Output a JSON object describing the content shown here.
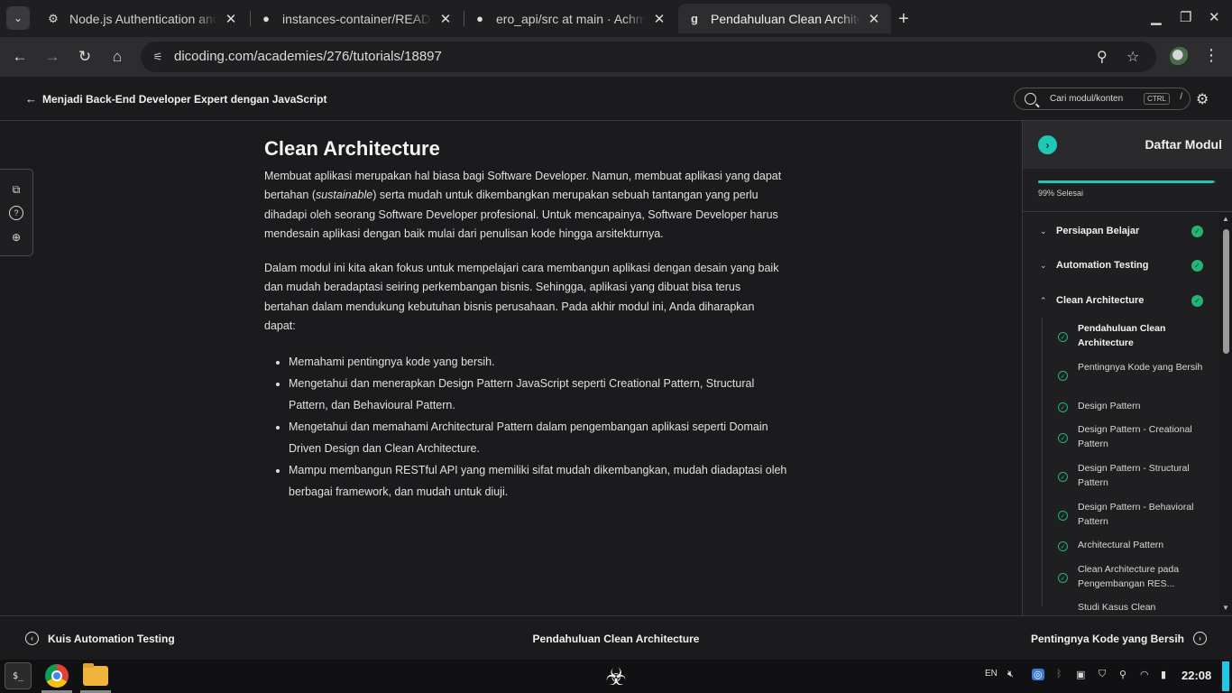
{
  "browser": {
    "tabs": [
      {
        "title": "Node.js Authentication and R",
        "icon": "settings-gear-icon"
      },
      {
        "title": "instances-container/READM",
        "icon": "github-icon"
      },
      {
        "title": "ero_api/src at main · Achmad",
        "icon": "github-icon"
      },
      {
        "title": "Pendahuluan Clean Architect",
        "icon": "dicoding-icon",
        "active": true
      }
    ],
    "url": "dicoding.com/academies/276/tutorials/18897"
  },
  "header": {
    "back_label": "Menjadi Back-End Developer Expert dengan JavaScript",
    "search_placeholder": "Cari modul/konten",
    "search_shortcut": "CTRL",
    "search_slash": "/"
  },
  "article": {
    "title": "Clean Architecture",
    "para1_a": "Membuat aplikasi merupakan hal biasa bagi Software Developer. Namun, membuat aplikasi yang dapat bertahan (",
    "para1_em": "sustainable",
    "para1_b": ") serta mudah untuk dikembangkan merupakan sebuah tantangan yang perlu dihadapi oleh seorang Software Developer profesional. Untuk mencapainya, Software Developer harus mendesain aplikasi dengan baik mulai dari penulisan kode hingga arsitekturnya.",
    "para2": "Dalam modul ini kita akan fokus untuk mempelajari cara membangun aplikasi dengan desain yang baik dan mudah beradaptasi seiring perkembangan bisnis. Sehingga, aplikasi yang dibuat bisa terus bertahan dalam mendukung kebutuhan bisnis perusahaan. Pada akhir modul ini, Anda diharapkan dapat:",
    "bullets": [
      "Memahami pentingnya kode yang bersih.",
      "Mengetahui dan menerapkan Design Pattern JavaScript seperti Creational Pattern, Structural Pattern, dan Behavioural Pattern.",
      "Mengetahui dan memahami Architectural Pattern dalam pengembangan aplikasi seperti Domain Driven Design dan Clean Architecture.",
      "Mampu membangun RESTful API yang memiliki sifat mudah dikembangkan, mudah diadaptasi oleh berbagai framework, dan mudah untuk diuji."
    ]
  },
  "sidebar": {
    "title": "Daftar Modul",
    "progress_percent": 99,
    "progress_text": "99% Selesai",
    "sections": [
      "Persiapan Belajar",
      "Automation Testing",
      "Clean Architecture"
    ],
    "items": [
      "Pendahuluan Clean Architecture",
      "Pentingnya Kode yang Bersih",
      "Design Pattern",
      "Design Pattern - Creational Pattern",
      "Design Pattern - Structural Pattern",
      "Design Pattern - Behavioral Pattern",
      "Architectural Pattern",
      "Clean Architecture pada Pengembangan RES...",
      "Studi Kasus Clean"
    ]
  },
  "bottom_nav": {
    "prev": "Kuis Automation Testing",
    "current": "Pendahuluan Clean Architecture",
    "next": "Pentingnya Kode yang Bersih"
  },
  "taskbar": {
    "lang": "EN",
    "time": "22:08"
  },
  "colors": {
    "accent": "#1ec8b7",
    "done": "#22b573",
    "background": "#1b1b1d"
  }
}
